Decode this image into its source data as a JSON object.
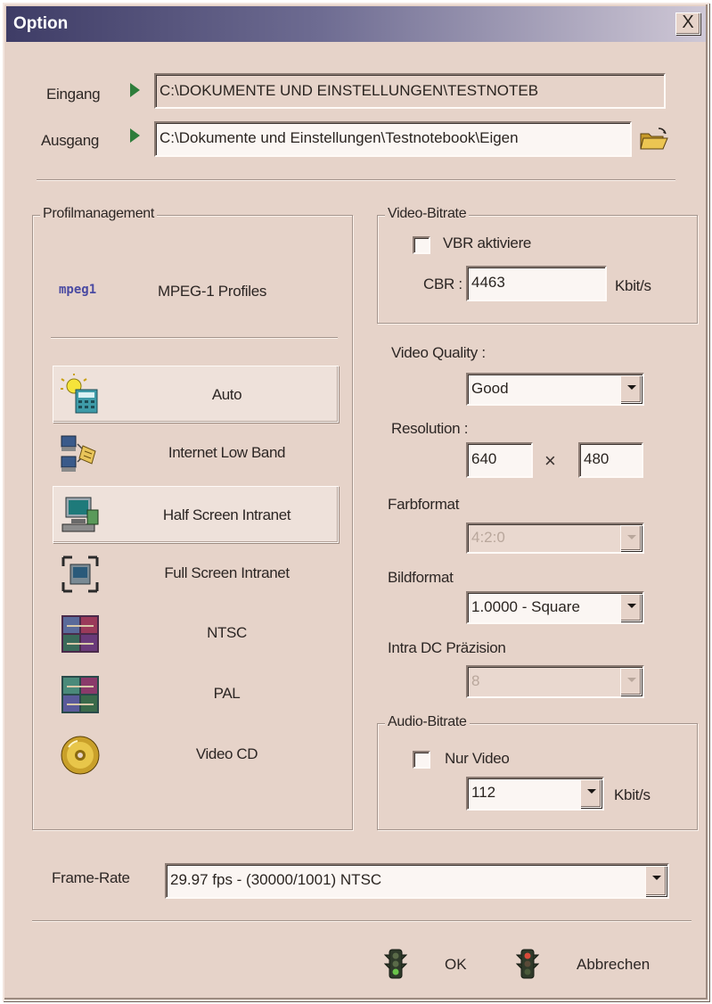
{
  "window": {
    "title": "Option",
    "close_glyph": "X"
  },
  "io": {
    "input_label": "Eingang",
    "input_value": "C:\\DOKUMENTE UND EINSTELLUNGEN\\TESTNOTEB",
    "output_label": "Ausgang",
    "output_value": "C:\\Dokumente und Einstellungen\\Testnotebook\\Eigen",
    "browse_icon": "folder-open-icon"
  },
  "profiles": {
    "group_title": "Profilmanagement",
    "badge": "mpeg1",
    "category": "MPEG-1 Profiles",
    "items": [
      {
        "label": "Auto",
        "icon": "auto-wizard-icon",
        "selected": true
      },
      {
        "label": "Internet Low Band",
        "icon": "network-computers-icon",
        "selected": false
      },
      {
        "label": "Half Screen Intranet",
        "icon": "half-screen-icon",
        "selected": true
      },
      {
        "label": "Full Screen Intranet",
        "icon": "full-screen-icon",
        "selected": false
      },
      {
        "label": "NTSC",
        "icon": "ntsc-icon",
        "selected": false
      },
      {
        "label": "PAL",
        "icon": "pal-icon",
        "selected": false
      },
      {
        "label": "Video CD",
        "icon": "video-cd-icon",
        "selected": false
      }
    ]
  },
  "video_bitrate": {
    "group_title": "Video-Bitrate",
    "vbr_label": "VBR aktiviere",
    "vbr_checked": false,
    "cbr_label": "CBR :",
    "cbr_value": "4463",
    "unit": "Kbit/s"
  },
  "video_quality": {
    "label": "Video Quality :",
    "value": "Good"
  },
  "resolution": {
    "label": "Resolution :",
    "width": "640",
    "times": "×",
    "height": "480"
  },
  "farbformat": {
    "label": "Farbformat",
    "value": "4:2:0",
    "enabled": false
  },
  "bildformat": {
    "label": "Bildformat",
    "value": "1.0000 - Square"
  },
  "intra_dc": {
    "label": "Intra DC Präzision",
    "value": "8",
    "enabled": false
  },
  "audio_bitrate": {
    "group_title": "Audio-Bitrate",
    "only_video_label": "Nur Video",
    "only_video_checked": false,
    "value": "112",
    "unit": "Kbit/s"
  },
  "frame_rate": {
    "label": "Frame-Rate",
    "value": "29.97 fps - (30000/1001) NTSC"
  },
  "buttons": {
    "ok_label": "OK",
    "ok_icon": "traffic-light-icon",
    "cancel_label": "Abbrechen",
    "cancel_icon": "traffic-light-icon"
  }
}
